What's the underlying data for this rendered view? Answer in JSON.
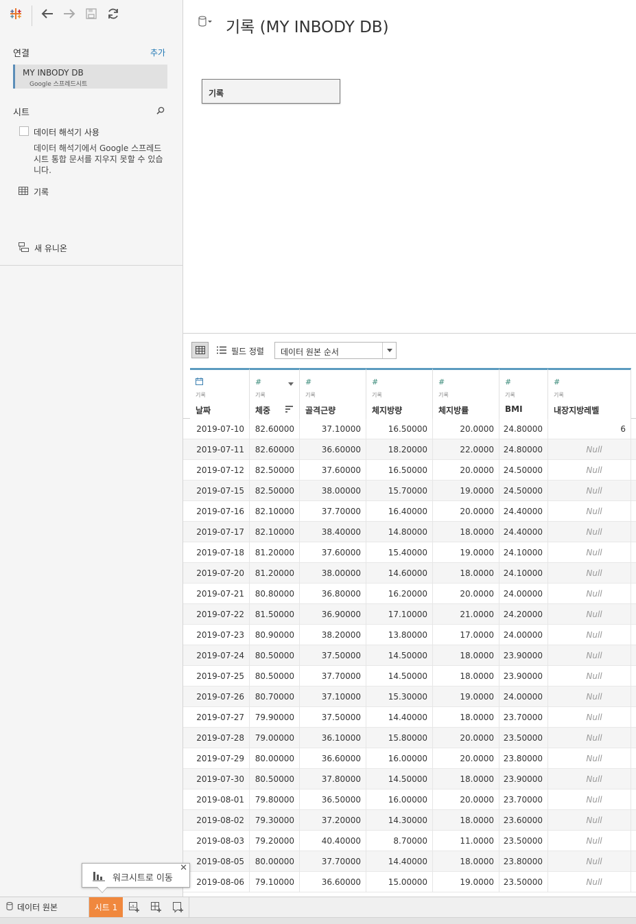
{
  "toolbar": {
    "logo": "tableau-logo-icon",
    "back": "back-arrow-icon",
    "forward": "forward-arrow-icon",
    "save": "save-icon",
    "refresh": "refresh-icon"
  },
  "connections": {
    "title": "연결",
    "add_label": "추가",
    "items": [
      {
        "name": "MY INBODY DB",
        "type": "Google 스프레드시트"
      }
    ]
  },
  "sheets": {
    "title": "시트",
    "interpreter_label": "데이터 해석기 사용",
    "interpreter_desc": "데이터 해석기에서 Google 스프레드시트 통합 문서를 지우지 못할 수 있습니다.",
    "items": [
      {
        "name": "기록"
      }
    ],
    "new_union": "새 유니온"
  },
  "canvas": {
    "title": "기록 (MY INBODY DB)",
    "table_box": "기록"
  },
  "grid_toolbar": {
    "sort_label": "필드 정렬",
    "sort_value": "데이터 원본 순서"
  },
  "grid": {
    "columns": [
      {
        "type_icon": "calendar-icon",
        "type_glyph": "📅",
        "source": "기록",
        "name": "날짜"
      },
      {
        "type_icon": "number-icon",
        "type_glyph": "#",
        "source": "기록",
        "name": "체중"
      },
      {
        "type_icon": "number-icon",
        "type_glyph": "#",
        "source": "기록",
        "name": "골격근량"
      },
      {
        "type_icon": "number-icon",
        "type_glyph": "#",
        "source": "기록",
        "name": "체지방량"
      },
      {
        "type_icon": "number-icon",
        "type_glyph": "#",
        "source": "기록",
        "name": "체지방률"
      },
      {
        "type_icon": "number-icon",
        "type_glyph": "#",
        "source": "기록",
        "name": "BMI"
      },
      {
        "type_icon": "number-icon",
        "type_glyph": "#",
        "source": "기록",
        "name": "내장지방레벨"
      }
    ],
    "rows": [
      [
        "2019-07-10",
        "82.60000",
        "37.10000",
        "16.50000",
        "20.0000",
        "24.80000",
        "6"
      ],
      [
        "2019-07-11",
        "82.60000",
        "36.60000",
        "18.20000",
        "22.0000",
        "24.80000",
        "Null"
      ],
      [
        "2019-07-12",
        "82.50000",
        "37.60000",
        "16.50000",
        "20.0000",
        "24.50000",
        "Null"
      ],
      [
        "2019-07-15",
        "82.50000",
        "38.00000",
        "15.70000",
        "19.0000",
        "24.50000",
        "Null"
      ],
      [
        "2019-07-16",
        "82.10000",
        "37.70000",
        "16.40000",
        "20.0000",
        "24.40000",
        "Null"
      ],
      [
        "2019-07-17",
        "82.10000",
        "38.40000",
        "14.80000",
        "18.0000",
        "24.40000",
        "Null"
      ],
      [
        "2019-07-18",
        "81.20000",
        "37.60000",
        "15.40000",
        "19.0000",
        "24.10000",
        "Null"
      ],
      [
        "2019-07-20",
        "81.20000",
        "38.00000",
        "14.60000",
        "18.0000",
        "24.10000",
        "Null"
      ],
      [
        "2019-07-21",
        "80.80000",
        "36.80000",
        "16.20000",
        "20.0000",
        "24.00000",
        "Null"
      ],
      [
        "2019-07-22",
        "81.50000",
        "36.90000",
        "17.10000",
        "21.0000",
        "24.20000",
        "Null"
      ],
      [
        "2019-07-23",
        "80.90000",
        "38.20000",
        "13.80000",
        "17.0000",
        "24.00000",
        "Null"
      ],
      [
        "2019-07-24",
        "80.50000",
        "37.50000",
        "14.50000",
        "18.0000",
        "23.90000",
        "Null"
      ],
      [
        "2019-07-25",
        "80.50000",
        "37.70000",
        "14.50000",
        "18.0000",
        "23.90000",
        "Null"
      ],
      [
        "2019-07-26",
        "80.70000",
        "37.10000",
        "15.30000",
        "19.0000",
        "24.00000",
        "Null"
      ],
      [
        "2019-07-27",
        "79.90000",
        "37.50000",
        "14.40000",
        "18.0000",
        "23.70000",
        "Null"
      ],
      [
        "2019-07-28",
        "79.00000",
        "36.10000",
        "15.80000",
        "20.0000",
        "23.50000",
        "Null"
      ],
      [
        "2019-07-29",
        "80.00000",
        "36.60000",
        "16.00000",
        "20.0000",
        "23.80000",
        "Null"
      ],
      [
        "2019-07-30",
        "80.50000",
        "37.80000",
        "14.50000",
        "18.0000",
        "23.90000",
        "Null"
      ],
      [
        "2019-08-01",
        "79.80000",
        "36.50000",
        "16.00000",
        "20.0000",
        "23.70000",
        "Null"
      ],
      [
        "2019-08-02",
        "79.30000",
        "37.20000",
        "14.30000",
        "18.0000",
        "23.60000",
        "Null"
      ],
      [
        "2019-08-03",
        "79.20000",
        "40.40000",
        "8.70000",
        "11.0000",
        "23.50000",
        "Null"
      ],
      [
        "2019-08-05",
        "80.00000",
        "37.70000",
        "14.40000",
        "18.0000",
        "23.80000",
        "Null"
      ],
      [
        "2019-08-06",
        "79.10000",
        "36.60000",
        "15.00000",
        "19.0000",
        "23.50000",
        "Null"
      ]
    ]
  },
  "tabs": {
    "data_source": "데이터 원본",
    "sheet": "시트 1",
    "new_sheet": "new-worksheet-icon",
    "new_dashboard": "new-dashboard-icon",
    "new_story": "new-story-icon"
  },
  "tooltip": {
    "text": "워크시트로 이동",
    "close": "✕"
  },
  "colors": {
    "accent_blue": "#5b9bbf",
    "sheet_tab": "#f0883e",
    "link": "#1f77b4",
    "type_green": "#3b8b7a"
  }
}
